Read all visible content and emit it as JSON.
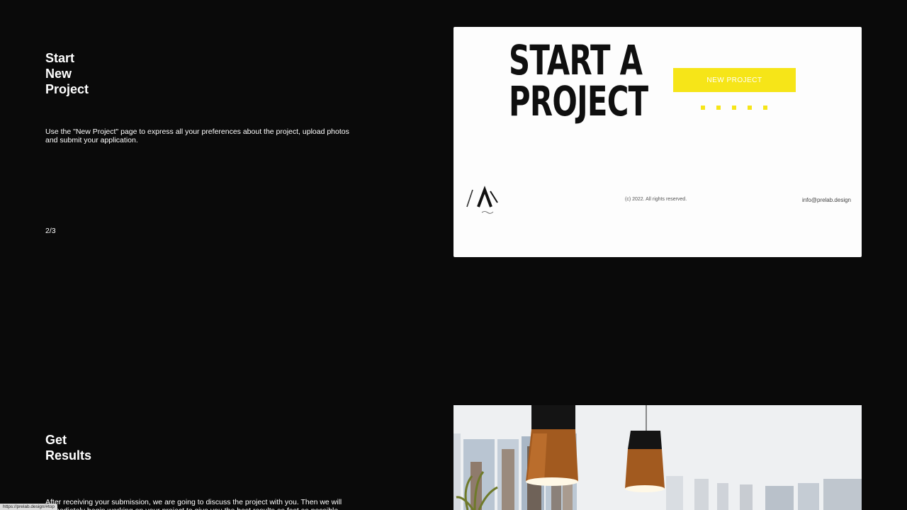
{
  "step2": {
    "title": "Start\nNew\nProject",
    "description": "Use the \"New Project\" page to express all your preferences about the project, upload photos and submit your application.",
    "counter": "2/3"
  },
  "preview": {
    "heading": "START A\nPROJECT",
    "button_label": "NEW PROJECT",
    "copyright": "(c) 2022. All rights reserved.",
    "email": "info@prelab.design",
    "accent_color": "#f6e518"
  },
  "step3": {
    "title": "Get\nResults",
    "description": "After receiving your submission, we are going to discuss the project with you. Then we will immediately begin working on your project to give you the best results as fast as possible."
  },
  "status_bar": {
    "url": "https://prelab.design/#top"
  }
}
